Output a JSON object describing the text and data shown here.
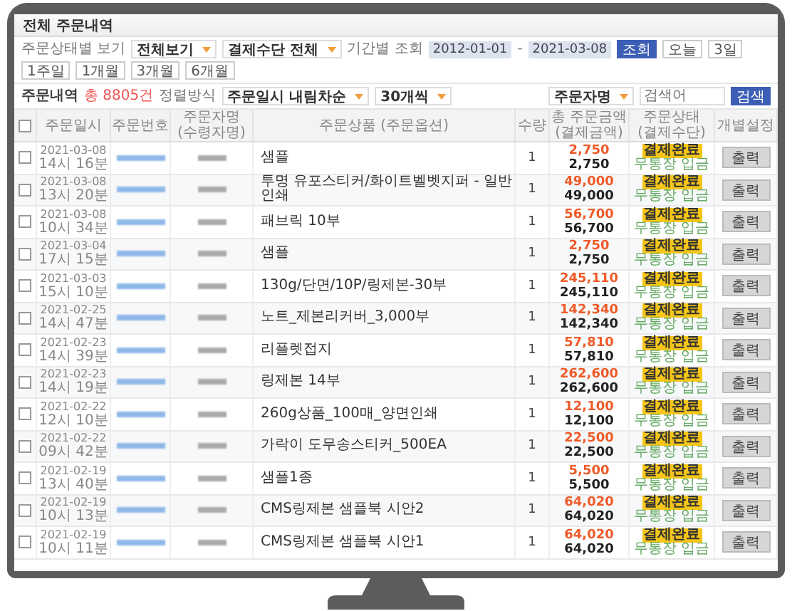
{
  "page_title": "전체 주문내역",
  "filters": {
    "status_label": "주문상태별 보기",
    "status_select": "전체보기",
    "payment_select": "결제수단 전체",
    "period_label": "기간별 조회",
    "date_from": "2012-01-01",
    "date_separator": "-",
    "date_to": "2021-03-08",
    "search_button": "조회",
    "period_buttons": [
      {
        "label": "오늘"
      },
      {
        "label": "3일"
      },
      {
        "label": "1주일"
      },
      {
        "label": "1개월"
      },
      {
        "label": "3개월"
      },
      {
        "label": "6개월"
      }
    ]
  },
  "summary": {
    "label": "주문내역",
    "count": "총 8805건",
    "sort_label": "정렬방식",
    "sort_select": "주문일시 내림차순",
    "per_page_select": "30개씩",
    "search_field_select": "주문자명",
    "search_placeholder": "검색어",
    "search_button": "검색"
  },
  "table": {
    "select_all_checked": false,
    "columns": [
      {
        "label": "주문일시"
      },
      {
        "label": "주문번호"
      },
      {
        "label": "주문자명",
        "sub": "(수령자명)"
      },
      {
        "label": "주문상품 (주문옵션)"
      },
      {
        "label": "수량"
      },
      {
        "label": "총 주문금액",
        "sub": "(결제금액)"
      },
      {
        "label": "주문상태",
        "sub": "(결제수단)"
      },
      {
        "label": "개별설정"
      }
    ],
    "rows": [
      {
        "checked": false,
        "date": "2021-03-08",
        "time": "14시 16분",
        "product": "샘플",
        "qty": "1",
        "total": "2,750",
        "paid": "2,750",
        "status": "결제완료",
        "method": "무통장 입금",
        "action": "출력"
      },
      {
        "checked": false,
        "date": "2021-03-08",
        "time": "13시 20분",
        "product": "투명 유포스티커/화이트벨벳지퍼 - 일반인쇄",
        "qty": "1",
        "total": "49,000",
        "paid": "49,000",
        "status": "결제완료",
        "method": "무통장 입금",
        "action": "출력"
      },
      {
        "checked": false,
        "date": "2021-03-08",
        "time": "10시 34분",
        "product": "패브릭 10부",
        "qty": "1",
        "total": "56,700",
        "paid": "56,700",
        "status": "결제완료",
        "method": "무통장 입금",
        "action": "출력"
      },
      {
        "checked": false,
        "date": "2021-03-04",
        "time": "17시 15분",
        "product": "샘플",
        "qty": "1",
        "total": "2,750",
        "paid": "2,750",
        "status": "결제완료",
        "method": "무통장 입금",
        "action": "출력"
      },
      {
        "checked": false,
        "date": "2021-03-03",
        "time": "15시 10분",
        "product": "130g/단면/10P/링제본-30부",
        "qty": "1",
        "total": "245,110",
        "paid": "245,110",
        "status": "결제완료",
        "method": "무통장 입금",
        "action": "출력"
      },
      {
        "checked": false,
        "date": "2021-02-25",
        "time": "14시 47분",
        "product": "노트_제본리커버_3,000부",
        "qty": "1",
        "total": "142,340",
        "paid": "142,340",
        "status": "결제완료",
        "method": "무통장 입금",
        "action": "출력"
      },
      {
        "checked": false,
        "date": "2021-02-23",
        "time": "14시 39분",
        "product": "리플렛접지",
        "qty": "1",
        "total": "57,810",
        "paid": "57,810",
        "status": "결제완료",
        "method": "무통장 입금",
        "action": "출력"
      },
      {
        "checked": false,
        "date": "2021-02-23",
        "time": "14시 19분",
        "product": "링제본 14부",
        "qty": "1",
        "total": "262,600",
        "paid": "262,600",
        "status": "결제완료",
        "method": "무통장 입금",
        "action": "출력"
      },
      {
        "checked": false,
        "date": "2021-02-22",
        "time": "12시 10분",
        "product": "260g상품_100매_양면인쇄",
        "qty": "1",
        "total": "12,100",
        "paid": "12,100",
        "status": "결제완료",
        "method": "무통장 입금",
        "action": "출력"
      },
      {
        "checked": false,
        "date": "2021-02-22",
        "time": "09시 42분",
        "product": "가락이 도무송스티커_500EA",
        "qty": "1",
        "total": "22,500",
        "paid": "22,500",
        "status": "결제완료",
        "method": "무통장 입금",
        "action": "출력"
      },
      {
        "checked": false,
        "date": "2021-02-19",
        "time": "13시 40분",
        "product": "샘플1종",
        "qty": "1",
        "total": "5,500",
        "paid": "5,500",
        "status": "결제완료",
        "method": "무통장 입금",
        "action": "출력"
      },
      {
        "checked": false,
        "date": "2021-02-19",
        "time": "10시 13분",
        "product": "CMS링제본 샘플북 시안2",
        "qty": "1",
        "total": "64,020",
        "paid": "64,020",
        "status": "결제완료",
        "method": "무통장 입금",
        "action": "출력"
      },
      {
        "checked": false,
        "date": "2021-02-19",
        "time": "10시 11분",
        "product": "CMS링제본 샘플북 시안1",
        "qty": "1",
        "total": "64,020",
        "paid": "64,020",
        "status": "결제완료",
        "method": "무통장 입금",
        "action": "출력"
      }
    ]
  }
}
